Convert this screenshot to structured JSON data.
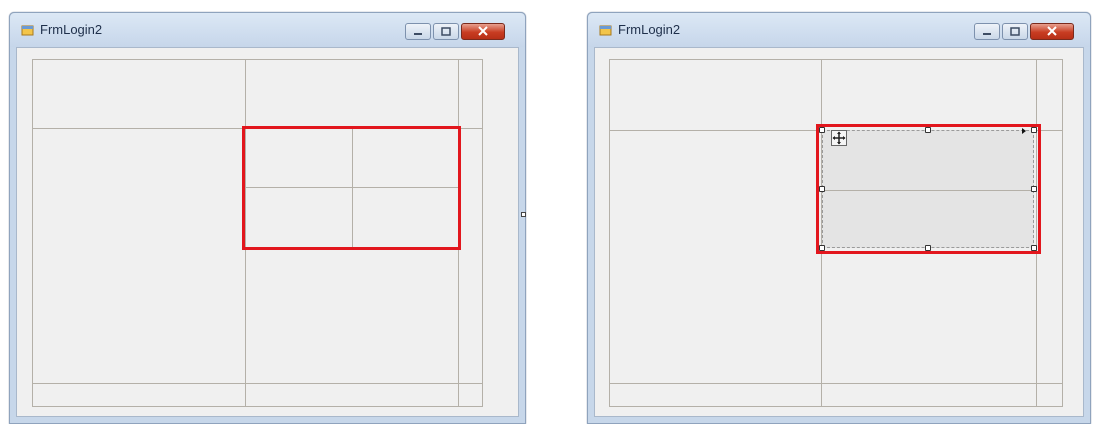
{
  "windows": [
    {
      "title": "FrmLogin2"
    },
    {
      "title": "FrmLogin2"
    }
  ],
  "colors": {
    "highlight": "#e2161d",
    "client_background": "#f0f0f0",
    "gridline": "#b4b0a8"
  },
  "icons": {
    "app": "form-icon",
    "minimize": "minimize-icon",
    "maximize": "maximize-icon",
    "close": "close-icon",
    "move": "move-icon"
  }
}
